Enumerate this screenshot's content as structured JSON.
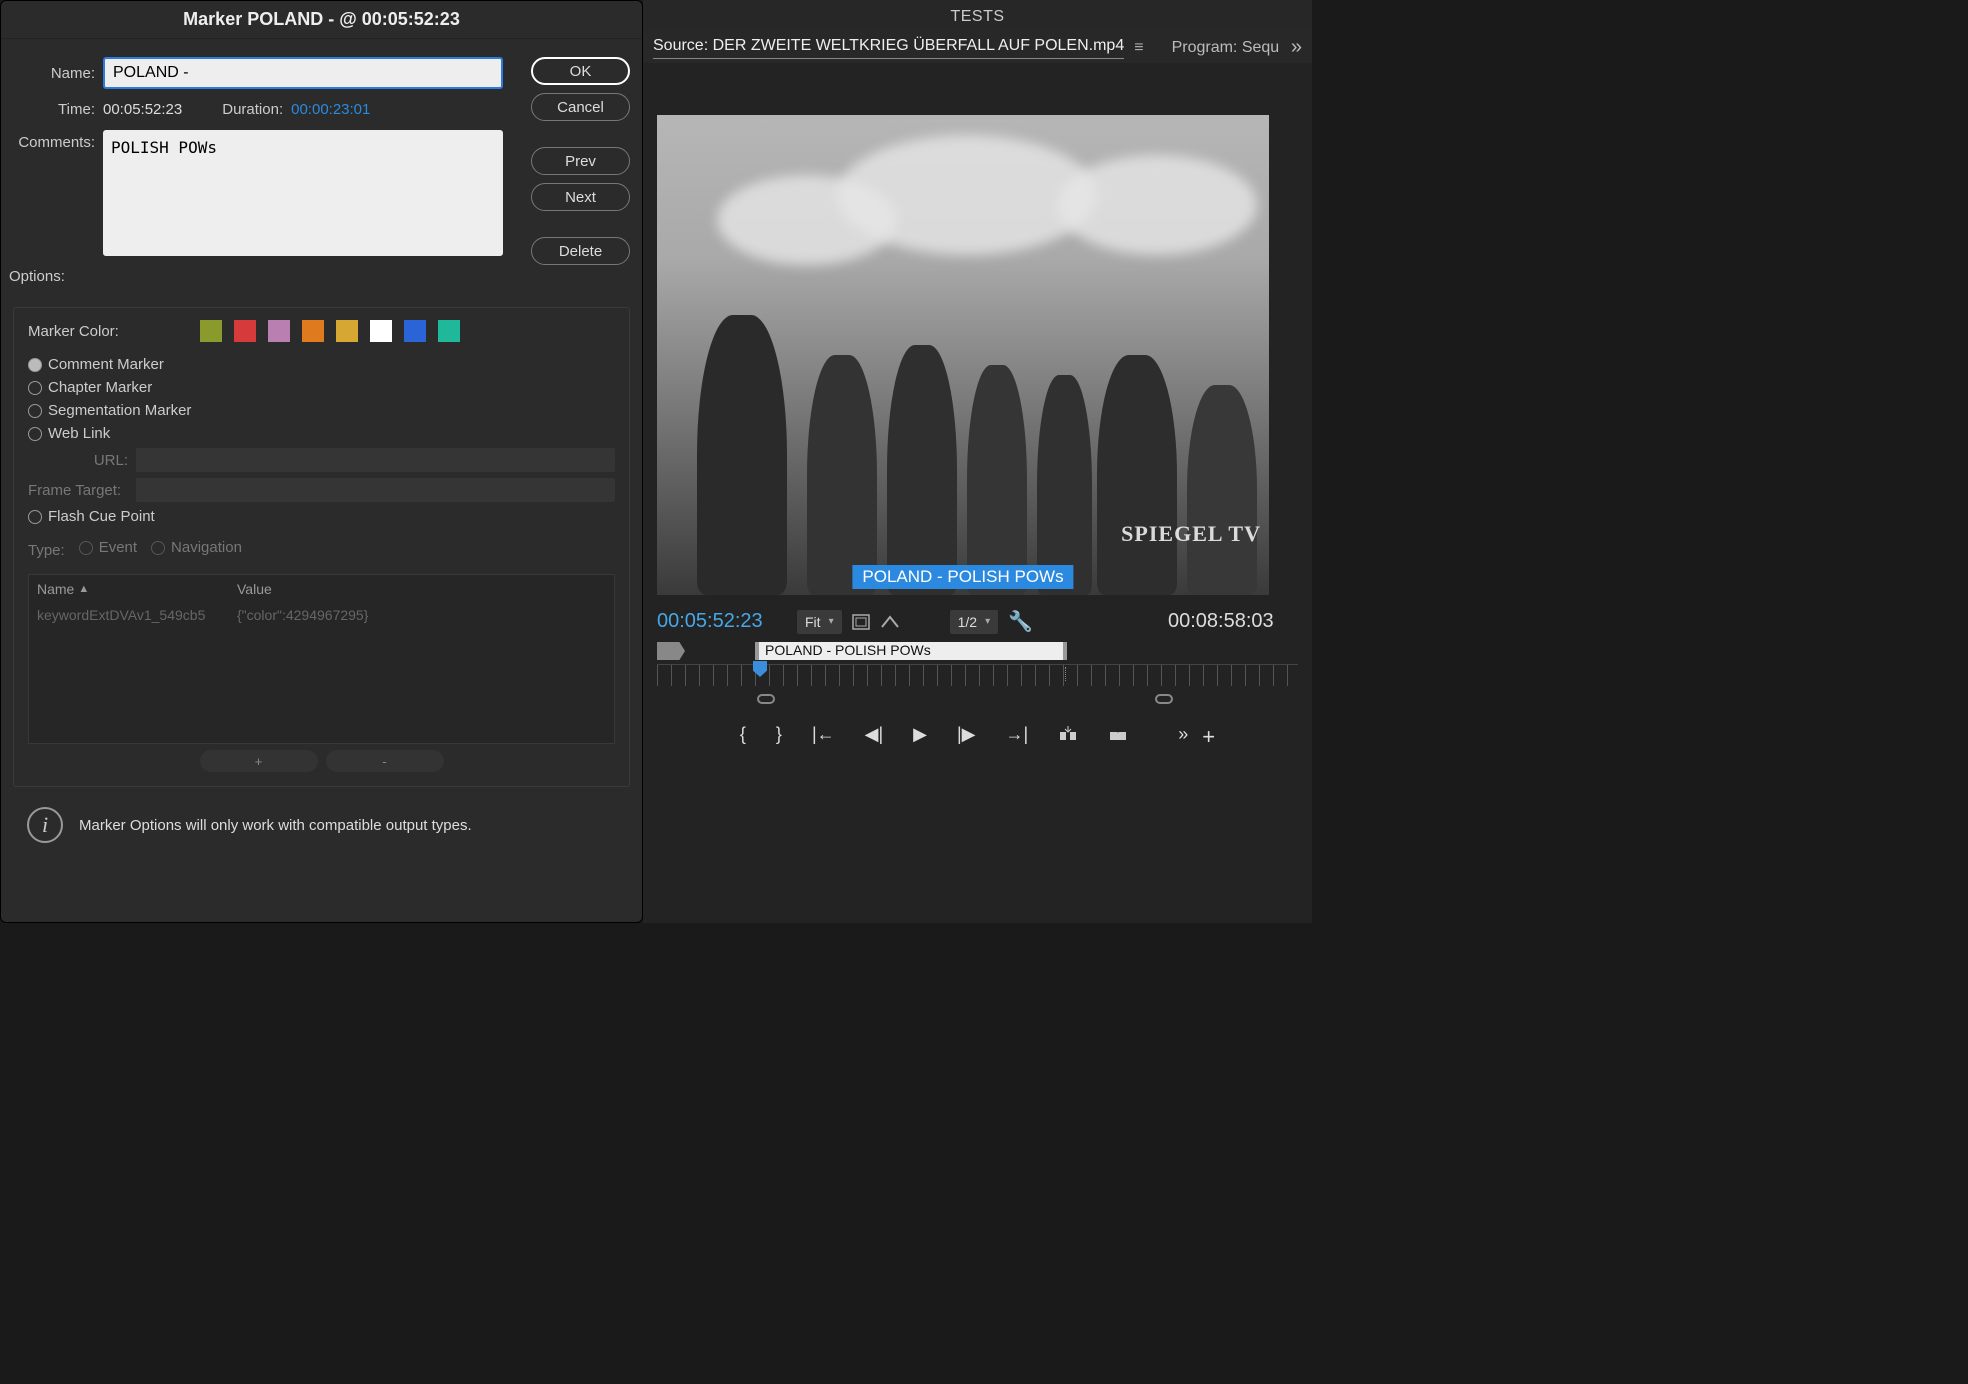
{
  "dialog": {
    "title": "Marker POLAND - @ 00:05:52:23",
    "name_label": "Name:",
    "name_value": "POLAND -",
    "time_label": "Time:",
    "time_value": "00:05:52:23",
    "duration_label": "Duration:",
    "duration_value": "00:00:23:01",
    "comments_label": "Comments:",
    "comments_value": "POLISH POWs",
    "buttons": {
      "ok": "OK",
      "cancel": "Cancel",
      "prev": "Prev",
      "next": "Next",
      "delete": "Delete"
    },
    "options": {
      "label": "Options:",
      "marker_color_label": "Marker Color:",
      "colors": [
        "#8a9a2c",
        "#d63a3a",
        "#b87fb0",
        "#e07a1f",
        "#d6a733",
        "#ffffff",
        "#2a64d6",
        "#1fb89a"
      ],
      "types": {
        "comment": "Comment Marker",
        "chapter": "Chapter Marker",
        "segmentation": "Segmentation Marker",
        "weblink": "Web Link",
        "flash": "Flash Cue Point"
      },
      "url_label": "URL:",
      "frame_target_label": "Frame Target:",
      "type_label": "Type:",
      "event_label": "Event",
      "navigation_label": "Navigation",
      "table": {
        "name_header": "Name",
        "value_header": "Value",
        "row_name": "keywordExtDVAv1_549cb5",
        "row_value": "{\"color\":4294967295}"
      },
      "plus": "+",
      "minus": "-"
    },
    "info_text": "Marker Options will only work with compatible output types."
  },
  "right": {
    "tests_label": "TESTS",
    "source_label": "Source: DER ZWEITE WELTKRIEG ÜBERFALL AUF POLEN.mp4",
    "program_label": "Program: Sequ",
    "overlay_text": "POLAND - POLISH POWs",
    "watermark": "SPIEGEL TV",
    "tc_in": "00:05:52:23",
    "fit_label": "Fit",
    "res_label": "1/2",
    "tc_out": "00:08:58:03",
    "strip_marker_label": "POLAND - POLISH POWs"
  }
}
